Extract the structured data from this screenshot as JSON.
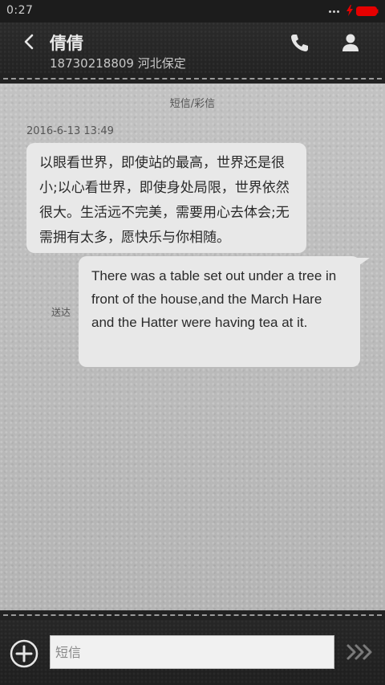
{
  "status_bar": {
    "time": "0:27",
    "icons": [
      "more-dots-icon",
      "charging-icon",
      "battery-icon"
    ],
    "battery_color": "#e60000",
    "charging_color": "#e60000"
  },
  "header": {
    "back_icon": "chevron-left-icon",
    "contact_name": "倩倩",
    "contact_detail": "18730218809 河北保定",
    "call_icon": "phone-icon",
    "profile_icon": "person-icon"
  },
  "conversation": {
    "message_type_label": "短信/彩信",
    "timestamp": "2016-6-13 13:49",
    "incoming_message": "以眼看世界，即使站的最高，世界还是很小;以心看世界，即使身处局限，世界依然很大。生活远不完美，需要用心去体会;无需拥有太多，愿快乐与你相随。",
    "outgoing_message": "There was a table set out under a tree in front of the house,and the March Hare and the Hatter were having tea at it.",
    "delivered_label": "送达"
  },
  "composer": {
    "add_icon": "plus-circle-icon",
    "input_placeholder": "短信",
    "input_value": "",
    "send_icon": "send-chevrons-icon"
  },
  "colors": {
    "header_bg": "#242424",
    "conversation_bg": "#bcbcbc",
    "bubble_bg": "#e8e8e8",
    "input_bg": "#f1f1f1"
  }
}
